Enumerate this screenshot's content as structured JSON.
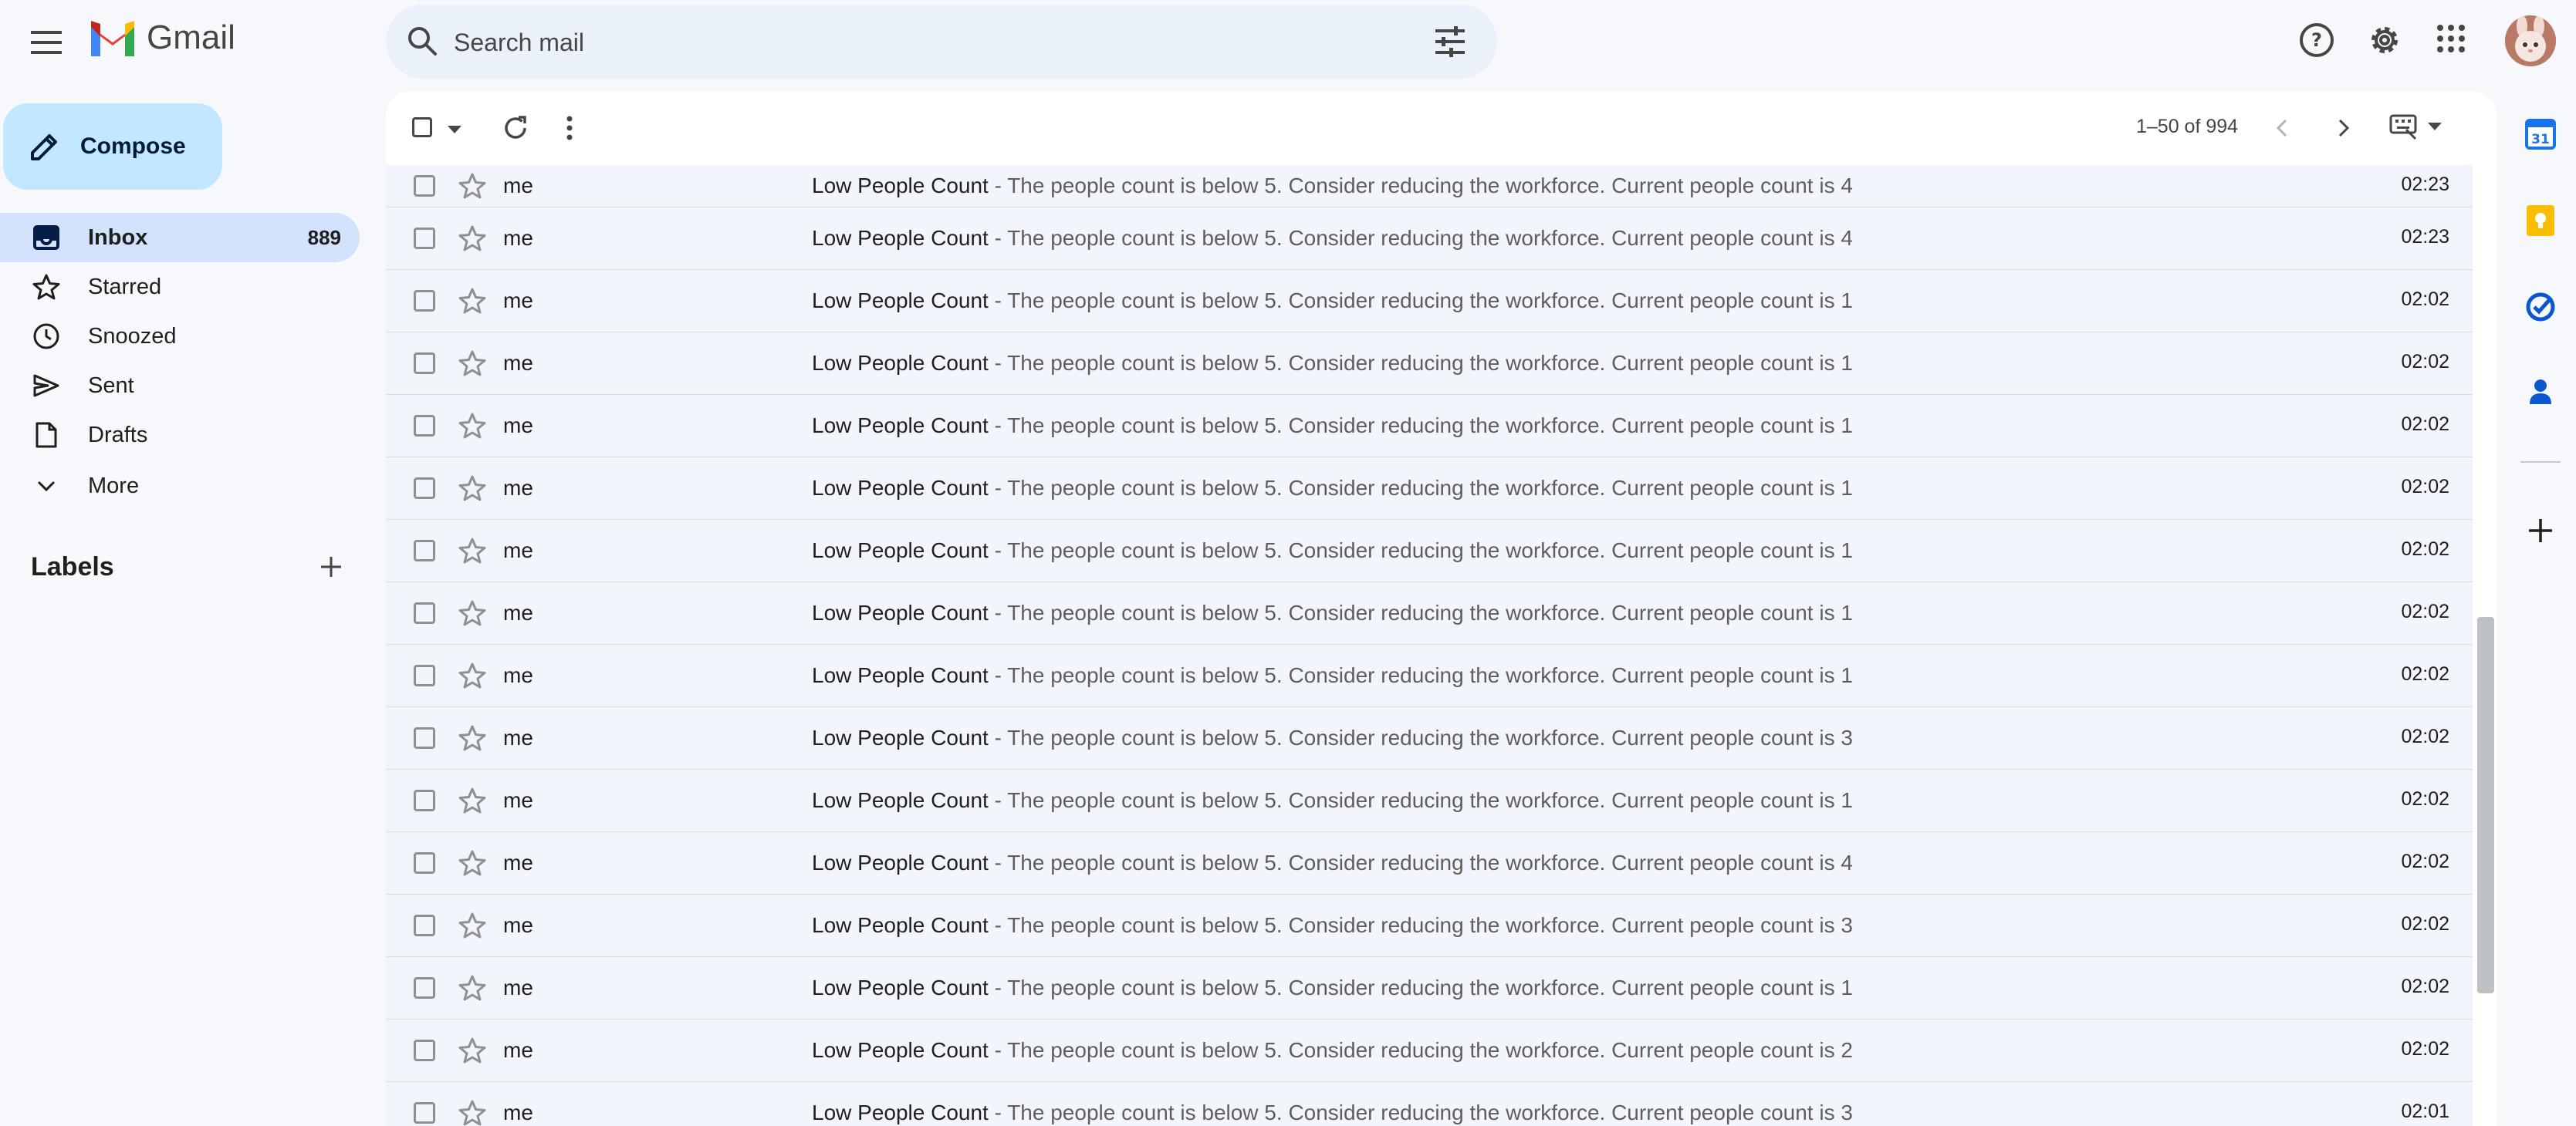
{
  "app": {
    "name": "Gmail"
  },
  "colors": {
    "accent": "#0b57d0",
    "compose_bg": "#c2e7ff",
    "active_nav": "#d3e3fd"
  },
  "search": {
    "placeholder": "Search mail"
  },
  "nav": {
    "compose_label": "Compose",
    "items": [
      {
        "label": "Inbox",
        "count": "889",
        "icon": "inbox-icon"
      },
      {
        "label": "Starred",
        "count": "",
        "icon": "star-icon"
      },
      {
        "label": "Snoozed",
        "count": "",
        "icon": "clock-icon"
      },
      {
        "label": "Sent",
        "count": "",
        "icon": "send-icon"
      },
      {
        "label": "Drafts",
        "count": "",
        "icon": "draft-icon"
      },
      {
        "label": "More",
        "count": "",
        "icon": "chevron-down-icon"
      }
    ],
    "labels_heading": "Labels"
  },
  "toolbar": {
    "pagination": "1–50 of 994"
  },
  "emails": [
    {
      "sender": "me",
      "subject": "Low People Count",
      "snippet": " - The people count is below 5. Consider reducing the workforce. Current people count is 4",
      "time": "02:23"
    },
    {
      "sender": "me",
      "subject": "Low People Count",
      "snippet": " - The people count is below 5. Consider reducing the workforce. Current people count is 4",
      "time": "02:23"
    },
    {
      "sender": "me",
      "subject": "Low People Count",
      "snippet": " - The people count is below 5. Consider reducing the workforce. Current people count is 1",
      "time": "02:02"
    },
    {
      "sender": "me",
      "subject": "Low People Count",
      "snippet": " - The people count is below 5. Consider reducing the workforce. Current people count is 1",
      "time": "02:02"
    },
    {
      "sender": "me",
      "subject": "Low People Count",
      "snippet": " - The people count is below 5. Consider reducing the workforce. Current people count is 1",
      "time": "02:02"
    },
    {
      "sender": "me",
      "subject": "Low People Count",
      "snippet": " - The people count is below 5. Consider reducing the workforce. Current people count is 1",
      "time": "02:02"
    },
    {
      "sender": "me",
      "subject": "Low People Count",
      "snippet": " - The people count is below 5. Consider reducing the workforce. Current people count is 1",
      "time": "02:02"
    },
    {
      "sender": "me",
      "subject": "Low People Count",
      "snippet": " - The people count is below 5. Consider reducing the workforce. Current people count is 1",
      "time": "02:02"
    },
    {
      "sender": "me",
      "subject": "Low People Count",
      "snippet": " - The people count is below 5. Consider reducing the workforce. Current people count is 1",
      "time": "02:02"
    },
    {
      "sender": "me",
      "subject": "Low People Count",
      "snippet": " - The people count is below 5. Consider reducing the workforce. Current people count is 3",
      "time": "02:02"
    },
    {
      "sender": "me",
      "subject": "Low People Count",
      "snippet": " - The people count is below 5. Consider reducing the workforce. Current people count is 1",
      "time": "02:02"
    },
    {
      "sender": "me",
      "subject": "Low People Count",
      "snippet": " - The people count is below 5. Consider reducing the workforce. Current people count is 4",
      "time": "02:02"
    },
    {
      "sender": "me",
      "subject": "Low People Count",
      "snippet": " - The people count is below 5. Consider reducing the workforce. Current people count is 3",
      "time": "02:02"
    },
    {
      "sender": "me",
      "subject": "Low People Count",
      "snippet": " - The people count is below 5. Consider reducing the workforce. Current people count is 1",
      "time": "02:02"
    },
    {
      "sender": "me",
      "subject": "Low People Count",
      "snippet": " - The people count is below 5. Consider reducing the workforce. Current people count is 2",
      "time": "02:02"
    },
    {
      "sender": "me",
      "subject": "Low People Count",
      "snippet": " - The people count is below 5. Consider reducing the workforce. Current people count is 3",
      "time": "02:01"
    }
  ],
  "side_panel": {
    "calendar_day": "31"
  }
}
